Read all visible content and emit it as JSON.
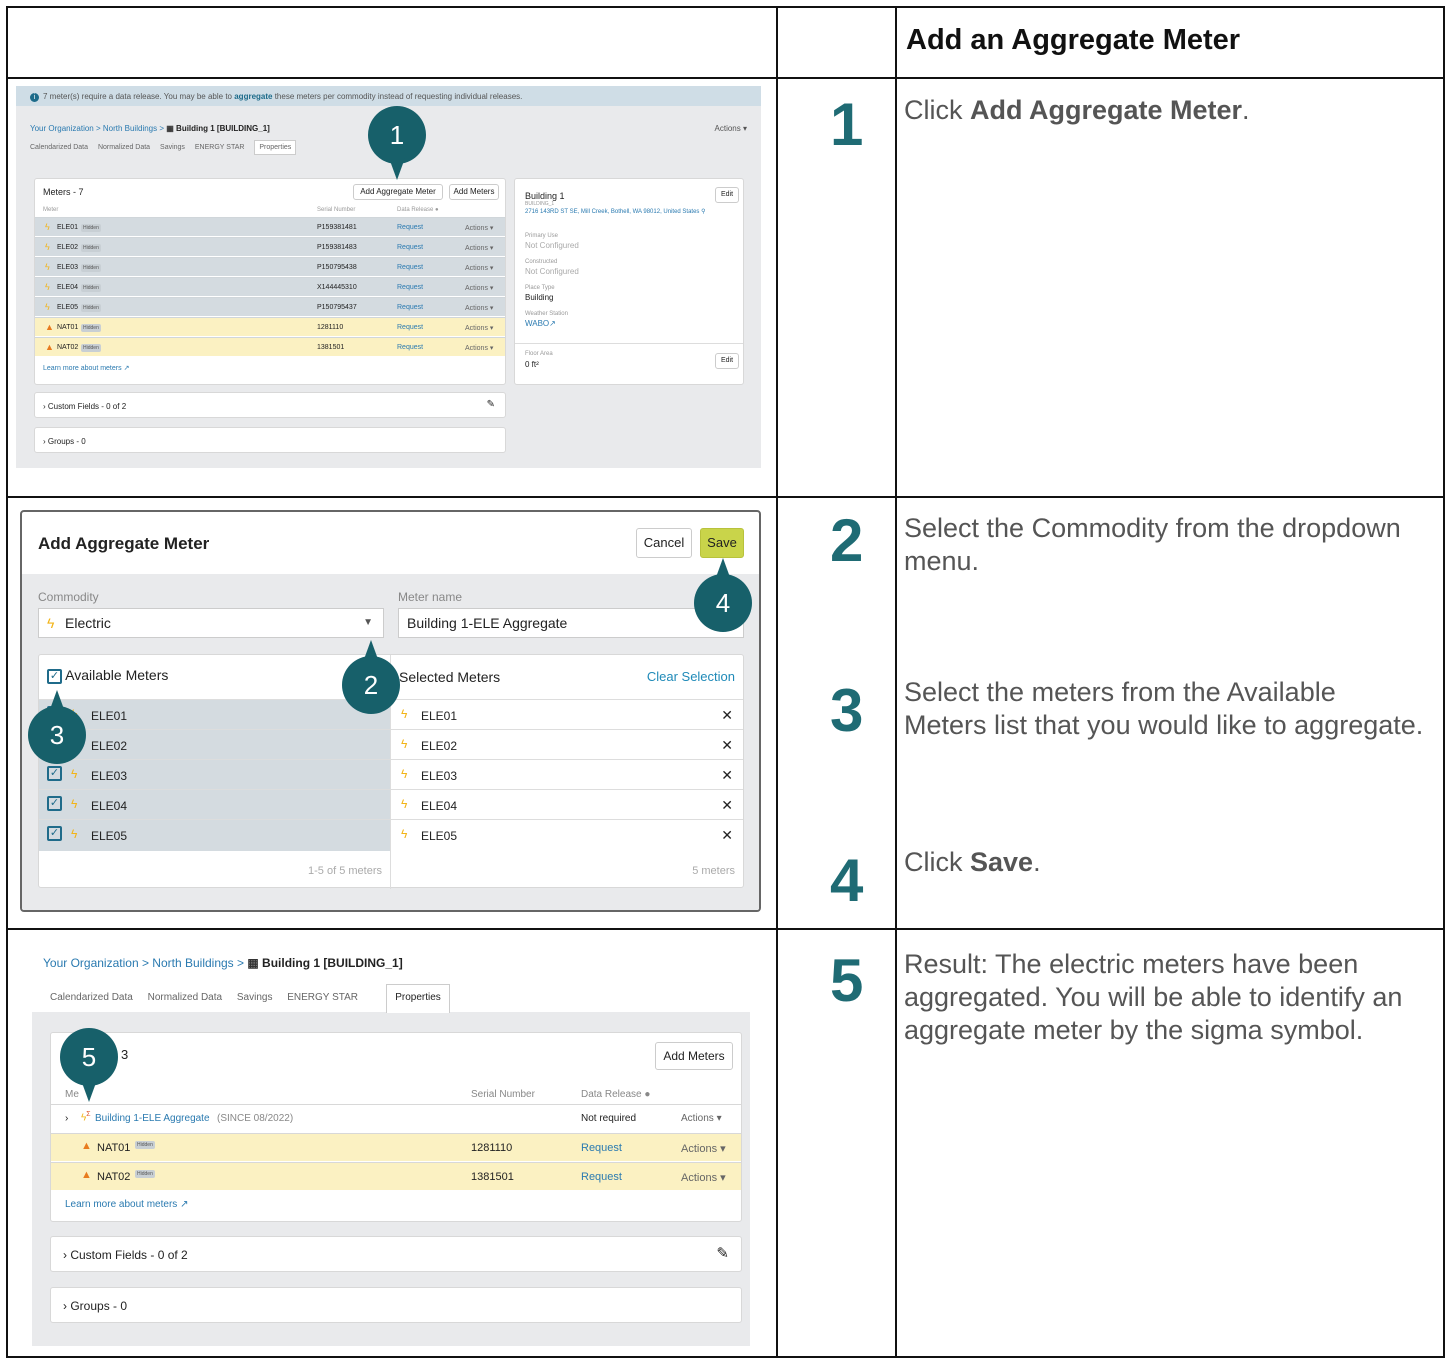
{
  "header": {
    "title": "Add an Aggregate Meter"
  },
  "steps": [
    {
      "num": "1",
      "pre": "Click ",
      "bold": "Add Aggregate Meter",
      "post": "."
    },
    {
      "num": "2",
      "text": "Select the Commodity from the dropdown menu."
    },
    {
      "num": "3",
      "text": "Select the meters from the Available Meters list that you would like to aggregate."
    },
    {
      "num": "4",
      "pre": "Click ",
      "bold": "Save",
      "post": "."
    },
    {
      "num": "5",
      "text": "Result: The electric meters have been aggregated. You will be able to identify an aggregate meter by the sigma symbol."
    }
  ],
  "shot1": {
    "banner_pre": "7 meter(s) require a data release. You may be able to ",
    "banner_link": "aggregate",
    "banner_post": " these meters per commodity instead of requesting individual releases.",
    "breadcrumb": "Your Organization > North Buildings >",
    "building": "Building 1 [BUILDING_1]",
    "actions": "Actions ▾",
    "tabs": [
      "Calendarized Data",
      "Normalized Data",
      "Savings",
      "ENERGY STAR",
      "Properties"
    ],
    "meters_title": "Meters - 7",
    "add_aggregate": "Add Aggregate Meter",
    "add_meters": "Add Meters",
    "col_meter": "Meter",
    "col_serial": "Serial Number",
    "col_release": "Data Release",
    "hidden": "Hidden",
    "request": "Request",
    "row_actions": "Actions ▾",
    "rows": [
      {
        "name": "ELE01",
        "serial": "P159381481",
        "type": "ele"
      },
      {
        "name": "ELE02",
        "serial": "P159381483",
        "type": "ele"
      },
      {
        "name": "ELE03",
        "serial": "P150795438",
        "type": "ele"
      },
      {
        "name": "ELE04",
        "serial": "X144445310",
        "type": "ele"
      },
      {
        "name": "ELE05",
        "serial": "P150795437",
        "type": "ele"
      },
      {
        "name": "NAT01",
        "serial": "1281110",
        "type": "nat"
      },
      {
        "name": "NAT02",
        "serial": "1381501",
        "type": "nat"
      }
    ],
    "learn_more": "Learn more about meters",
    "custom_fields": "Custom Fields - 0 of 2",
    "groups": "Groups - 0",
    "side": {
      "name": "Building 1",
      "id": "BUILDING_1",
      "address": "2716 143RD ST SE, Mill Creek, Bothell, WA 98012, United States",
      "edit": "Edit",
      "primary_use_label": "Primary Use",
      "primary_use": "Not Configured",
      "constructed_label": "Constructed",
      "constructed": "Not Configured",
      "place_type_label": "Place Type",
      "place_type": "Building",
      "weather_label": "Weather Station",
      "weather": "WABO",
      "floor_label": "Floor Area",
      "floor": "0 ft²"
    },
    "pin": "1"
  },
  "shot2": {
    "title": "Add Aggregate Meter",
    "cancel": "Cancel",
    "save": "Save",
    "commodity_label": "Commodity",
    "commodity": "Electric",
    "meter_name_label": "Meter name",
    "meter_name": "Building 1-ELE Aggregate",
    "available": "Available Meters",
    "selected": "Selected Meters",
    "clear": "Clear Selection",
    "meters": [
      "ELE01",
      "ELE02",
      "ELE03",
      "ELE04",
      "ELE05"
    ],
    "avail_count": "1-5 of 5 meters",
    "sel_count": "5 meters",
    "pins": [
      "2",
      "3",
      "4"
    ]
  },
  "shot3": {
    "breadcrumb": "Your Organization > North Buildings >",
    "building": "Building 1 [BUILDING_1]",
    "tabs": [
      "Calendarized Data",
      "Normalized Data",
      "Savings",
      "ENERGY STAR",
      "Properties"
    ],
    "meters_count": "3",
    "col_meter": "Me",
    "add_meters": "Add Meters",
    "col_serial": "Serial Number",
    "col_release": "Data Release",
    "agg_name": "Building 1-ELE Aggregate",
    "agg_since": "(SINCE 08/2022)",
    "not_required": "Not required",
    "row_actions": "Actions ▾",
    "hidden": "Hidden",
    "request": "Request",
    "rows": [
      {
        "name": "NAT01",
        "serial": "1281110"
      },
      {
        "name": "NAT02",
        "serial": "1381501"
      }
    ],
    "learn_more": "Learn more about meters",
    "custom_fields": "Custom Fields - 0 of 2",
    "groups": "Groups - 0",
    "pin": "5"
  }
}
